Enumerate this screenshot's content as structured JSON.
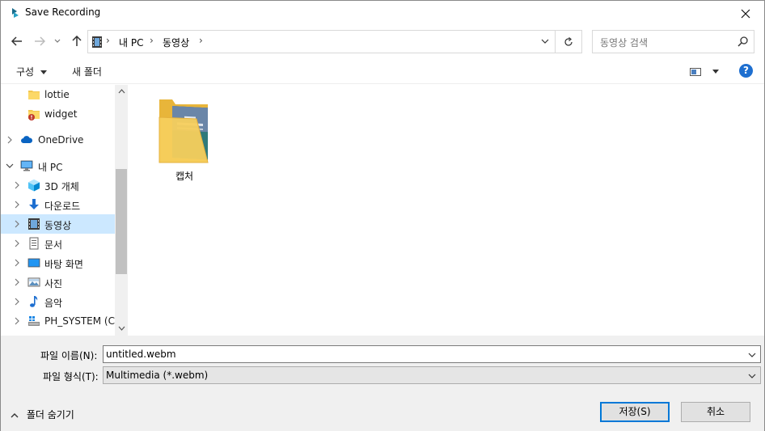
{
  "window": {
    "title": "Save Recording",
    "close_label": "✕"
  },
  "address_bar": {
    "crumbs": [
      "내 PC",
      "동영상"
    ],
    "sep": "›"
  },
  "search": {
    "placeholder": "동영상 검색"
  },
  "toolbar": {
    "organize_label": "구성",
    "new_folder_label": "새 폴더",
    "help_label": "?"
  },
  "nav_pane": {
    "items": [
      {
        "label": "lottie",
        "icon": "folder-icon"
      },
      {
        "label": "widget",
        "icon": "folder-warning-icon"
      },
      {
        "label": "OneDrive",
        "icon": "cloud-icon"
      },
      {
        "label": "내 PC",
        "icon": "pc-icon"
      },
      {
        "label": "3D 개체",
        "icon": "cube-icon"
      },
      {
        "label": "다운로드",
        "icon": "download-icon"
      },
      {
        "label": "동영상",
        "icon": "video-icon"
      },
      {
        "label": "문서",
        "icon": "document-icon"
      },
      {
        "label": "바탕 화면",
        "icon": "desktop-icon"
      },
      {
        "label": "사진",
        "icon": "pictures-icon"
      },
      {
        "label": "음악",
        "icon": "music-icon"
      },
      {
        "label": "PH_SYSTEM (C:)",
        "icon": "drive-icon"
      }
    ]
  },
  "content": {
    "items": [
      {
        "label": "캡처",
        "icon": "folder-with-preview-icon"
      }
    ]
  },
  "form": {
    "filename_label": "파일 이름(N):",
    "filename_value": "untitled.webm",
    "filetype_label": "파일 형식(T):",
    "filetype_value": "Multimedia (*.webm)"
  },
  "footer": {
    "hide_folders_label": "폴더 숨기기",
    "save_label": "저장(S)",
    "cancel_label": "취소"
  },
  "colors": {
    "accent": "#0078d7",
    "selection": "#cce8ff",
    "help": "#1e6fd0",
    "folder": "#f3c64d"
  }
}
